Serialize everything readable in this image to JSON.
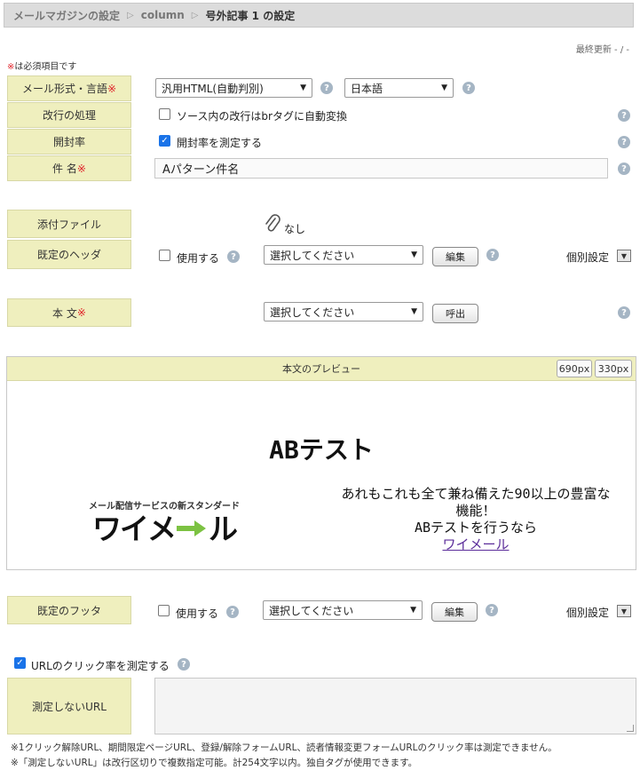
{
  "breadcrumb": {
    "items": [
      "メールマガジンの設定",
      "column"
    ],
    "current": "号外記事 1 の設定"
  },
  "last_updated": "最終更新 - / -",
  "required_note": {
    "mark": "※",
    "text": "は必須項目です"
  },
  "form": {
    "mail_format": {
      "label": "メール形式・言語",
      "required_mark": "※",
      "format_value": "汎用HTML(自動判別)",
      "language_value": "日本語"
    },
    "line_break": {
      "label": "改行の処理",
      "checkbox_label": "ソース内の改行はbrタグに自動変換",
      "checked": false
    },
    "open_rate": {
      "label": "開封率",
      "checkbox_label": "開封率を測定する",
      "checked": true
    },
    "subject": {
      "label": "件 名",
      "required_mark": "※",
      "value": "Aパターン件名"
    },
    "attachment": {
      "label": "添付ファイル",
      "value": "なし"
    },
    "header": {
      "label": "既定のヘッダ",
      "use_label": "使用する",
      "select_value": "選択してください",
      "edit_button": "編集",
      "individual_label": "個別設定"
    },
    "body": {
      "label": "本 文",
      "required_mark": "※",
      "select_value": "選択してください",
      "call_button": "呼出"
    },
    "footer": {
      "label": "既定のフッタ",
      "use_label": "使用する",
      "select_value": "選択してください",
      "edit_button": "編集",
      "individual_label": "個別設定"
    }
  },
  "preview": {
    "header_label": "本文のプレビュー",
    "width_buttons": [
      "690px",
      "330px"
    ],
    "title": "ABテスト",
    "logo_tagline": "メール配信サービスの新スタンダード",
    "logo_text_left": "ワイメ",
    "logo_text_right": "ル",
    "promo_line1": "あれもこれも全て兼ね備えた90以上の豊富な",
    "promo_line2": "機能！",
    "promo_line3": "ABテストを行うなら",
    "promo_link": "ワイメール"
  },
  "url_tracking": {
    "checkbox_label": "URLのクリック率を測定する",
    "checked": true,
    "exclude_label": "測定しないURL",
    "notes": [
      "※1クリック解除URL、期間限定ページURL、登録/解除フォームURL、読者情報変更フォームURLのクリック率は測定できません。",
      "※「測定しないURL」は改行区切りで複数指定可能。計254文字以内。独自タグが使用できます。"
    ]
  },
  "icons": {
    "help": "question-circle-icon",
    "paperclip": "paperclip-icon",
    "dropdown": "caret-down-icon",
    "checkmark": "check-icon"
  },
  "colors": {
    "label_bg": "#efefbe",
    "required": "#e0242b",
    "help_icon": "#a5b5c4",
    "checkbox_checked": "#1a73e8",
    "logo_arrow": "#7cc242",
    "link": "#5b2d9a"
  }
}
